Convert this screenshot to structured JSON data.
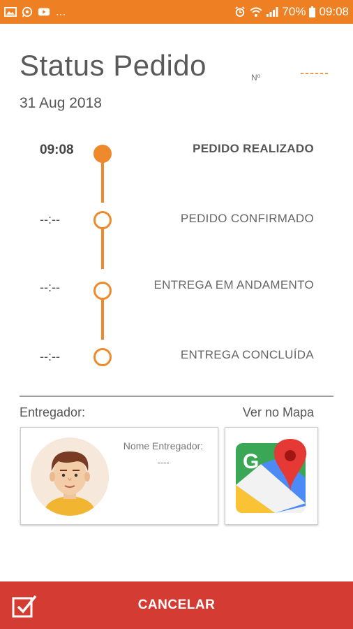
{
  "status_bar": {
    "icons_left": [
      "image-icon",
      "whatsapp-icon",
      "youtube-icon"
    ],
    "overflow": "...",
    "icons_right": [
      "alarm-icon",
      "wifi-icon",
      "signal-icon",
      "battery-icon"
    ],
    "battery": "70%",
    "time": "09:08"
  },
  "header": {
    "title": "Status Pedido",
    "order_label": "Nº",
    "order_value": "------",
    "date": "31 Aug 2018"
  },
  "timeline": [
    {
      "time": "09:08",
      "label": "PEDIDO REALIZADO",
      "done": true
    },
    {
      "time": "--:--",
      "label": "PEDIDO CONFIRMADO",
      "done": false
    },
    {
      "time": "--:--",
      "label": "ENTREGA EM ANDAMENTO",
      "done": false
    },
    {
      "time": "--:--",
      "label": "ENTREGA CONCLUÍDA",
      "done": false
    }
  ],
  "courier": {
    "section_label": "Entregador:",
    "name_label": "Nome Entregador:",
    "name_value": "----"
  },
  "map": {
    "link_label": "Ver no Mapa"
  },
  "actions": {
    "cancel_label": "CANCELAR"
  },
  "colors": {
    "accent": "#ee7f22",
    "cancel": "#d43b32"
  }
}
